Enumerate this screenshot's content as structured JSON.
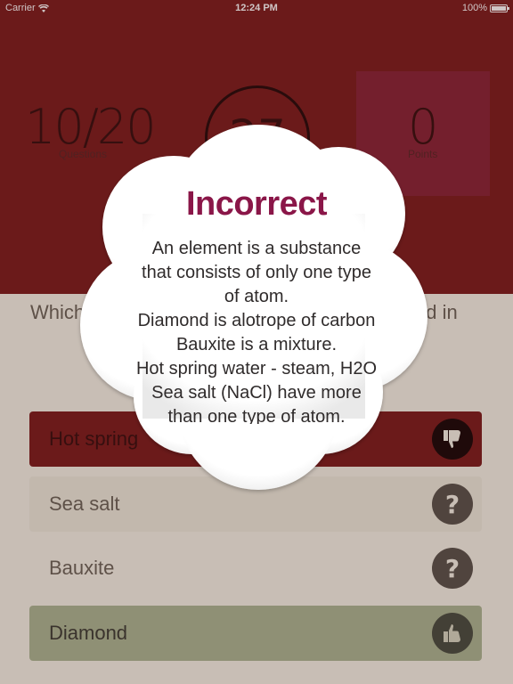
{
  "status_bar": {
    "carrier": "Carrier",
    "time": "12:24 PM",
    "battery": "100%"
  },
  "stats": {
    "questions_value": "10/20",
    "questions_label": "Questions",
    "timer_value": "27",
    "points_value": "0",
    "points_label": "Points"
  },
  "question": {
    "text_left": "Which st",
    "text_right": "nd in"
  },
  "answers": [
    {
      "label": "Hot spring",
      "state": "wrong",
      "icon": "thumbs-down-icon"
    },
    {
      "label": "Sea salt",
      "state": "unknown",
      "icon": "question-icon",
      "icon_glyph": "?"
    },
    {
      "label": "Bauxite",
      "state": "unknown",
      "icon": "question-icon",
      "icon_glyph": "?"
    },
    {
      "label": "Diamond",
      "state": "correct",
      "icon": "thumbs-up-icon"
    }
  ],
  "popup": {
    "title": "Incorrect",
    "lines": [
      "An element is a substance",
      "that consists of only one type",
      "of atom.",
      "Diamond is alotrope of carbon",
      "Bauxite is a mixture.",
      "Hot spring water - steam, H2O",
      "Sea salt (NaCl) have more",
      "than one type of atom."
    ]
  },
  "colors": {
    "header_red": "#7a1c1c",
    "title_magenta": "#8a1648",
    "correct_green": "#a7ab8a",
    "cream": "#ece3d8"
  }
}
